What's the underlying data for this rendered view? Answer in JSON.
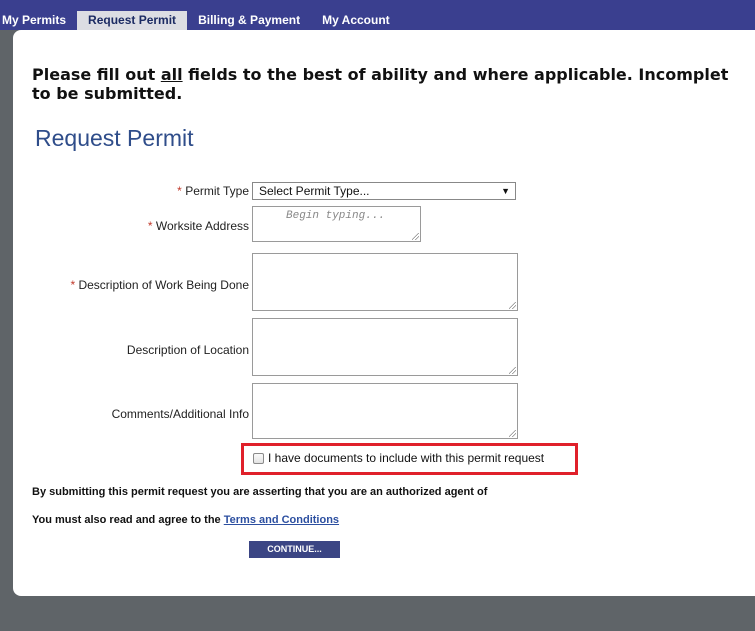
{
  "nav": {
    "tabs": [
      {
        "label": "My Permits"
      },
      {
        "label": "Request Permit"
      },
      {
        "label": "Billing & Payment"
      },
      {
        "label": "My Account"
      }
    ]
  },
  "notice": {
    "before": "Please fill out ",
    "underlined": "all",
    "after": " fields to the best of ability and where applicable. Incomplet",
    "line2": "to be submitted."
  },
  "page_title": "Request Permit",
  "form": {
    "required_mark": "*",
    "permit_type_label": "Permit Type",
    "permit_type_value": "Select Permit Type...",
    "worksite_label": "Worksite Address",
    "worksite_placeholder": "Begin typing...",
    "work_desc_label": "Description of Work Being Done",
    "location_desc_label": "Description of Location",
    "comments_label": "Comments/Additional Info",
    "documents_checkbox_label": "I have documents to include with this permit request"
  },
  "footer": {
    "assertion_text": "By submitting this permit request you are asserting that you are an authorized agent of",
    "terms_prefix": "You must also read and agree to the ",
    "terms_link": "Terms and Conditions",
    "continue_label": "CONTINUE..."
  },
  "colors": {
    "nav_bg": "#3a3f8f",
    "title": "#2f4d8a",
    "required": "#c0392b",
    "highlight": "#e0202a",
    "button": "#3b4584"
  }
}
